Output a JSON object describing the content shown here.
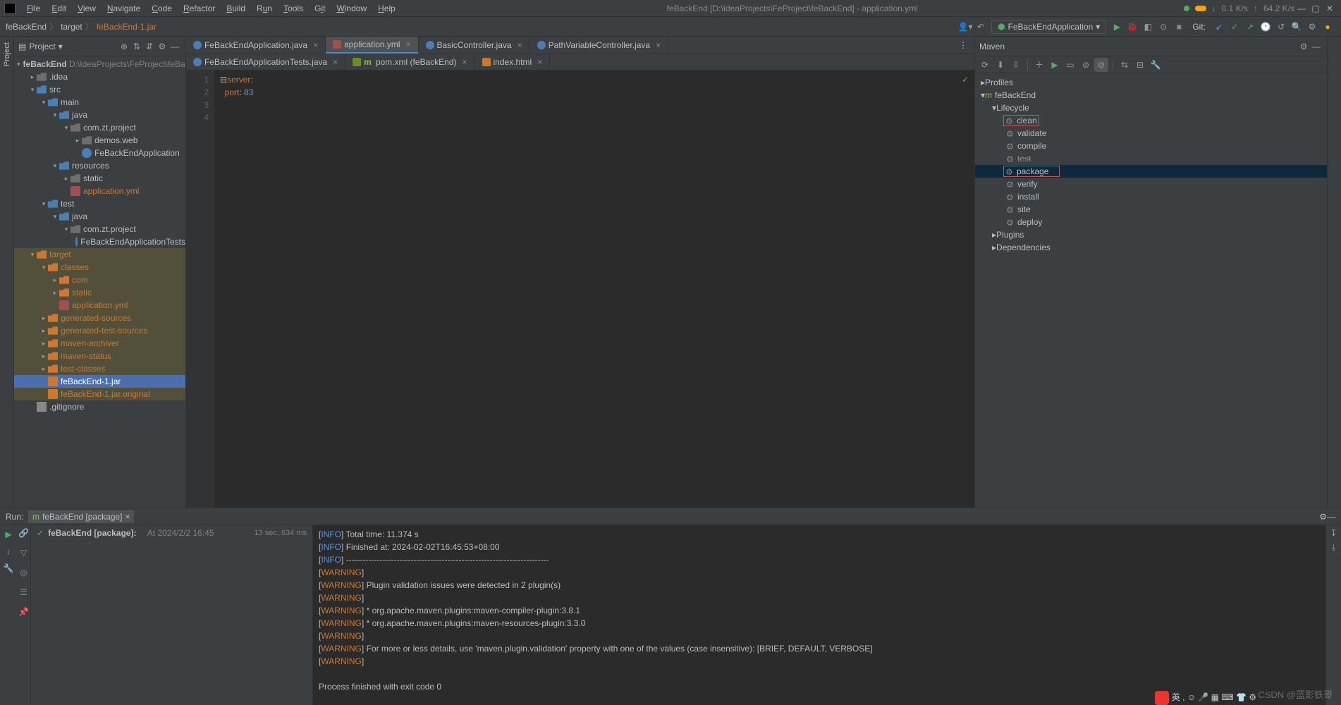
{
  "menu": {
    "items": [
      "File",
      "Edit",
      "View",
      "Navigate",
      "Code",
      "Refactor",
      "Build",
      "Run",
      "Tools",
      "Git",
      "Window",
      "Help"
    ]
  },
  "title": "feBackEnd [D:\\IdeaProjects\\FeProject\\feBackEnd] - application.yml",
  "stats": {
    "down": "0.1 K/s",
    "up": "64.2 K/s"
  },
  "breadcrumb": {
    "a": "feBackEnd",
    "b": "target",
    "c": "feBackEnd-1.jar"
  },
  "runcfg": "FeBackEndApplication",
  "git_label": "Git:",
  "project": {
    "title": "Project",
    "root": "feBackEnd",
    "rootpath": "D:\\IdeaProjects\\FeProject\\feBackE",
    "idea": ".idea",
    "src": "src",
    "main": "main",
    "java": "java",
    "pkg": "com.zt.project",
    "demos": "demos.web",
    "app": "FeBackEndApplication",
    "resources": "resources",
    "static": "static",
    "appyml": "application.yml",
    "test": "test",
    "java2": "java",
    "pkg2": "com.zt.project",
    "tests": "FeBackEndApplicationTests",
    "target": "target",
    "classes": "classes",
    "com": "com",
    "static2": "static",
    "appyml2": "application.yml",
    "gensrc": "generated-sources",
    "gentest": "generated-test-sources",
    "marchiver": "maven-archiver",
    "mstatus": "maven-status",
    "testcls": "test-classes",
    "jar": "feBackEnd-1.jar",
    "jarorg": "feBackEnd-1.jar.original",
    "gitignore": ".gitignore"
  },
  "tabs": [
    {
      "label": "FeBackEndApplication.java",
      "ic": "class"
    },
    {
      "label": "application.yml",
      "ic": "yaml",
      "active": true
    },
    {
      "label": "BasicController.java",
      "ic": "class"
    },
    {
      "label": "PathVariableController.java",
      "ic": "class"
    }
  ],
  "tabs2": [
    {
      "label": "FeBackEndApplicationTests.java",
      "ic": "class"
    },
    {
      "label": "pom.xml (feBackEnd)",
      "ic": "xml"
    },
    {
      "label": "index.html",
      "ic": "html"
    }
  ],
  "code": {
    "l1a": "server",
    "l1b": ":",
    "l2a": "port",
    "l2b": ": ",
    "l2c": "83"
  },
  "gutter": [
    "1",
    "2",
    "3",
    "4"
  ],
  "maven": {
    "title": "Maven",
    "profiles": "Profiles",
    "root": "feBackEnd",
    "lifecycle": "Lifecycle",
    "clean": "clean",
    "validate": "validate",
    "compile": "compile",
    "test": "test",
    "package": "package",
    "verify": "verify",
    "install": "install",
    "site": "site",
    "deploy": "deploy",
    "plugins": "Plugins",
    "deps": "Dependencies"
  },
  "run": {
    "label": "Run:",
    "tab": "feBackEnd [package]",
    "tree": "feBackEnd [package]:",
    "treedate": "At 2024/2/2 16:45",
    "dur": "13 sec, 634 ms"
  },
  "console": [
    {
      "t": "INFO",
      "msg": " Total time:  11.374 s"
    },
    {
      "t": "INFO",
      "msg": " Finished at: 2024-02-02T16:45:53+08:00"
    },
    {
      "t": "INFO",
      "msg": " ------------------------------------------------------------------------"
    },
    {
      "t": "WARNING",
      "msg": " "
    },
    {
      "t": "WARNING",
      "msg": " Plugin validation issues were detected in 2 plugin(s)"
    },
    {
      "t": "WARNING",
      "msg": " "
    },
    {
      "t": "WARNING",
      "msg": "  * org.apache.maven.plugins:maven-compiler-plugin:3.8.1"
    },
    {
      "t": "WARNING",
      "msg": "  * org.apache.maven.plugins:maven-resources-plugin:3.3.0"
    },
    {
      "t": "WARNING",
      "msg": " "
    },
    {
      "t": "WARNING",
      "msg": " For more or less details, use 'maven.plugin.validation' property with one of the values (case insensitive): [BRIEF, DEFAULT, VERBOSE]"
    },
    {
      "t": "WARNING",
      "msg": " "
    }
  ],
  "exit": "Process finished with exit code 0",
  "watermark": "CSDN @蓝影铁哥"
}
